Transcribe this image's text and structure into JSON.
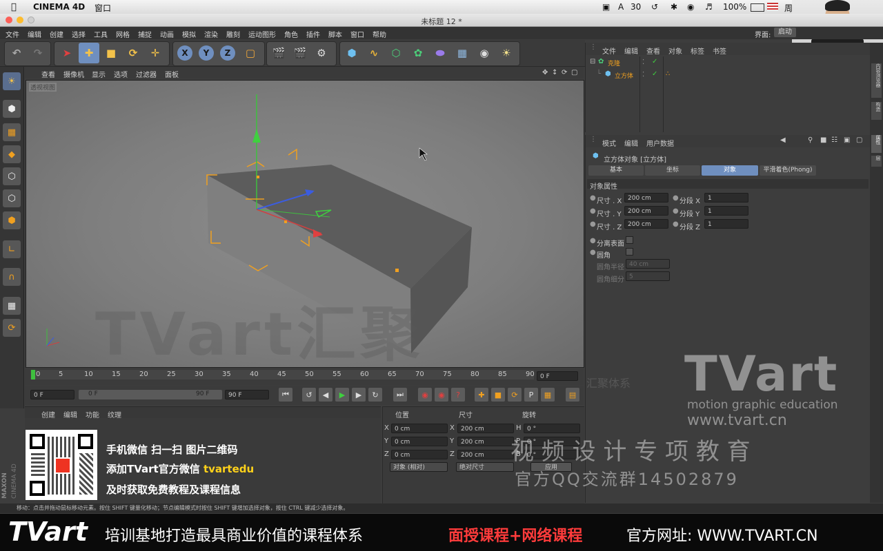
{
  "mac_menubar": {
    "app": "CINEMA 4D",
    "menu_window": "窗口",
    "badge_ai": "30",
    "battery": "100%",
    "clock_partial": "周"
  },
  "window": {
    "title": "未标题 12 *"
  },
  "app_menu": [
    "文件",
    "编辑",
    "创建",
    "选择",
    "工具",
    "网格",
    "捕捉",
    "动画",
    "模拟",
    "渲染",
    "雕刻",
    "运动图形",
    "角色",
    "插件",
    "脚本",
    "窗口",
    "帮助"
  ],
  "layout_label": "界面:",
  "layout_value": "启动",
  "toolbar": {
    "axis_x": "X",
    "axis_y": "Y",
    "axis_z": "Z"
  },
  "viewport": {
    "menu": [
      "查看",
      "摄像机",
      "显示",
      "选项",
      "过滤器",
      "面板"
    ],
    "label": "透视视图",
    "watermark": "TVart汇聚"
  },
  "timeline": {
    "ticks": [
      "0",
      "5",
      "10",
      "15",
      "20",
      "25",
      "30",
      "35",
      "40",
      "45",
      "50",
      "55",
      "60",
      "65",
      "70",
      "75",
      "80",
      "85",
      "90"
    ],
    "end_field": "0 F",
    "start_field": "0 F",
    "range_start": "0 F",
    "range_end": "90 F",
    "max_field": "90 F"
  },
  "material_panel": {
    "menu": [
      "创建",
      "编辑",
      "功能",
      "纹理"
    ]
  },
  "coord_panel": {
    "headers": {
      "pos": "位置",
      "size": "尺寸",
      "rot": "旋转"
    },
    "rows": [
      {
        "axis": "X",
        "pos": "0 cm",
        "saxis": "X",
        "size": "200 cm",
        "raxis": "H",
        "rot": "0 °"
      },
      {
        "axis": "Y",
        "pos": "0 cm",
        "saxis": "Y",
        "size": "200 cm",
        "raxis": "P",
        "rot": "0 °"
      },
      {
        "axis": "Z",
        "pos": "0 cm",
        "saxis": "Z",
        "size": "200 cm",
        "raxis": "B",
        "rot": "0 °"
      }
    ],
    "mode_object": "对象 (相对)",
    "mode_size": "绝对尺寸",
    "apply": "应用"
  },
  "object_panel": {
    "menu": [
      "文件",
      "编辑",
      "查看",
      "对象",
      "标签",
      "书签"
    ],
    "items": [
      {
        "name": "克隆"
      },
      {
        "name": "立方体"
      }
    ]
  },
  "attr_panel": {
    "menu": [
      "模式",
      "编辑",
      "用户数据"
    ],
    "object_title": "立方体对象 [立方体]",
    "tabs": [
      "基本",
      "坐标",
      "对象",
      "平滑着色(Phong)"
    ],
    "section": "对象属性",
    "size_rows": [
      {
        "label": "尺寸 . X",
        "value": "200 cm",
        "seg_label": "分段 X",
        "seg": "1"
      },
      {
        "label": "尺寸 . Y",
        "value": "200 cm",
        "seg_label": "分段 Y",
        "seg": "1"
      },
      {
        "label": "尺寸 . Z",
        "value": "200 cm",
        "seg_label": "分段 Z",
        "seg": "1"
      }
    ],
    "separate_surfaces": "分离表面",
    "fillet": "圆角",
    "fillet_radius_label": "圆角半径",
    "fillet_radius": "40 cm",
    "fillet_sub_label": "圆角细分",
    "fillet_sub": "5"
  },
  "right_strip": [
    "内容浏览器",
    "构造",
    "属性",
    "层"
  ],
  "status": "移动：点击并拖动鼠标移动元素。按住 SHIFT 键量化移动；节点编辑模式时按住 SHIFT 键增加选择对象，按住 CTRL 键减少选择对象。",
  "promo": {
    "line1": "手机微信  扫一扫  图片二维码",
    "line2a": "添加TVart官方微信 ",
    "line2b": "tvartedu",
    "line3": "及时获取免费教程及课程信息",
    "tvart_logo": "TVart",
    "motion_text": "motion graphic education",
    "url_text": "www.tvart.cn",
    "slogan": "视 频 设 计 专 项 教 育",
    "qq": "官方QQ交流群14502879",
    "ghost": "汇聚体系"
  },
  "banner": {
    "logo": "TVart",
    "text1": "培训基地打造最具商业价值的课程体系",
    "text2": "面授课程+网络课程",
    "text3": "官方网址: WWW.TVART.CN"
  },
  "maxon": {
    "brand": "MAXON",
    "product": "CINEMA 4D"
  },
  "colors": {
    "accent_blue": "#6f8fbf",
    "orange": "#f0a020",
    "yellow_text": "#ffd21a",
    "red_text": "#ff3b3b"
  }
}
